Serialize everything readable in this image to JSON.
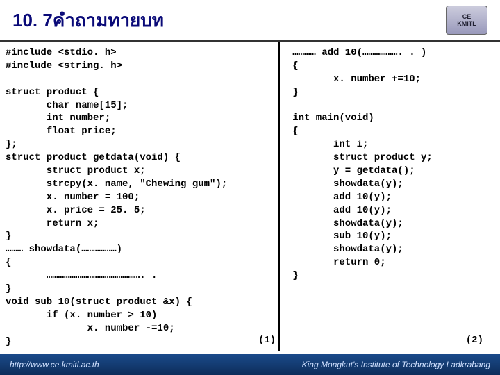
{
  "header": {
    "title": "10. 7คำถามทายบท",
    "logo_top": "CE",
    "logo_bottom": "KMITL"
  },
  "left_code": "#include <stdio. h>\n#include <string. h>\n\nstruct product {\n       char name[15];\n       int number;\n       float price;\n};\nstruct product getdata(void) {\n       struct product x;\n       strcpy(x. name, \"Chewing gum\");\n       x. number = 100;\n       x. price = 25. 5;\n       return x;\n}\n……… showdata(………………)\n{\n       …………………………………………. .\n}\nvoid sub 10(struct product &x) {\n       if (x. number > 10)\n              x. number -=10;\n}",
  "right_code": "………… add 10(………………. . )\n{\n       x. number +=10;\n}\n\nint main(void)\n{\n       int i;\n       struct product y;\n       y = getdata();\n       showdata(y);\n       add 10(y);\n       add 10(y);\n       showdata(y);\n       sub 10(y);\n       showdata(y);\n       return 0;\n}",
  "page_left": "(1)",
  "page_right": "(2)",
  "footer": {
    "left": "http://www.ce.kmitl.ac.th",
    "right": "King Mongkut's Institute of Technology Ladkrabang"
  }
}
